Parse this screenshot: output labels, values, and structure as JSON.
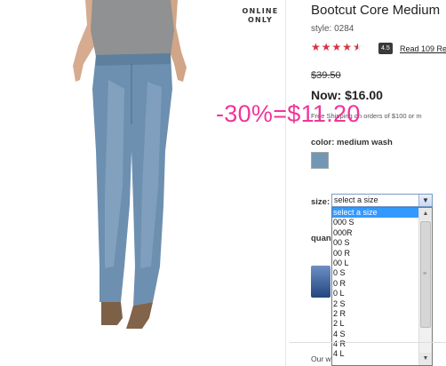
{
  "product": {
    "online_only_line1": "ONLINE",
    "online_only_line2": "ONLY",
    "title": "Bootcut Core Medium",
    "style": "style: 0284",
    "rating": 4.5,
    "rating_badge": "4.5",
    "reviews_link": "Read 109 Re",
    "original_price": "$39.50",
    "now_price": "Now: $16.00",
    "shipping_note": "Free Shipping on orders of $100 or m",
    "color_label": "color:",
    "color_value": "medium wash",
    "swatch_color": "#7396b4",
    "size_label": "size:",
    "size_selected": "select a size",
    "size_options": [
      "select a size",
      "000 S",
      "000R",
      "00 S",
      "00 R",
      "00 L",
      "0 S",
      "0 R",
      "0 L",
      "2 S",
      "2 R",
      "2 L",
      "4 S",
      "4 R",
      "4 L"
    ],
    "quantity_label": "quan",
    "bottom_text": "Our w"
  },
  "annotation": {
    "text": "-30%=$11.20",
    "color": "#f0359b"
  },
  "icons": {
    "dropdown_arrow": "▼",
    "scroll_up": "▲",
    "scroll_down": "▼",
    "scroll_grip": "≡"
  }
}
